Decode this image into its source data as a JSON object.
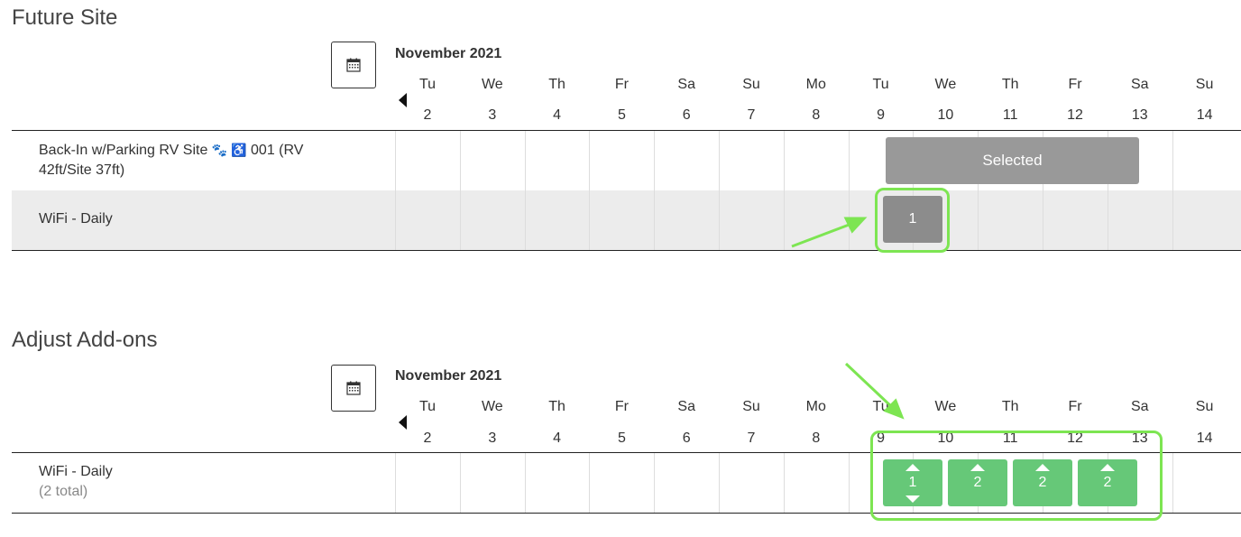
{
  "future_site": {
    "title": "Future Site",
    "month": "November 2021",
    "days": [
      {
        "dow": "Tu",
        "num": "2"
      },
      {
        "dow": "We",
        "num": "3"
      },
      {
        "dow": "Th",
        "num": "4"
      },
      {
        "dow": "Fr",
        "num": "5"
      },
      {
        "dow": "Sa",
        "num": "6"
      },
      {
        "dow": "Su",
        "num": "7"
      },
      {
        "dow": "Mo",
        "num": "8"
      },
      {
        "dow": "Tu",
        "num": "9"
      },
      {
        "dow": "We",
        "num": "10"
      },
      {
        "dow": "Th",
        "num": "11"
      },
      {
        "dow": "Fr",
        "num": "12"
      },
      {
        "dow": "Sa",
        "num": "13"
      },
      {
        "dow": "Su",
        "num": "14"
      }
    ],
    "site_label": "Back-In w/Parking RV Site",
    "site_icons": "🐾 ♿",
    "site_label_rest": "001 (RV",
    "site_label_line2": "42ft/Site 37ft)",
    "selected_label": "Selected",
    "wifi_label": "WiFi - Daily",
    "wifi_qty": "1"
  },
  "adjust_addons": {
    "title": "Adjust Add-ons",
    "month": "November 2021",
    "wifi_label": "WiFi - Daily",
    "wifi_total": "(2 total)",
    "quantities": [
      "1",
      "2",
      "2",
      "2"
    ]
  },
  "icons": {
    "calendar": "calendar-icon",
    "prev": "prev-arrow-icon",
    "up": "increment-icon",
    "down": "decrement-icon"
  },
  "colors": {
    "selected_gray": "#999999",
    "qty_gray": "#8c8c8c",
    "qty_green": "#66c878",
    "highlight": "#7de552"
  }
}
